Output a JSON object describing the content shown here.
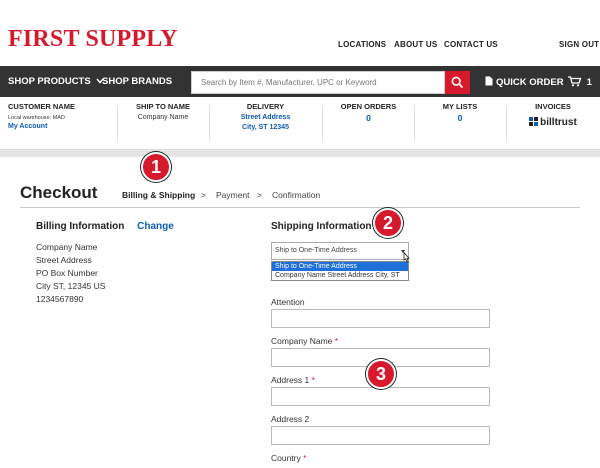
{
  "header": {
    "logo": "FIRST SUPPLY",
    "links": [
      "LOCATIONS",
      "ABOUT US",
      "CONTACT US",
      "SIGN OUT"
    ]
  },
  "nav": {
    "shop_products": "SHOP PRODUCTS",
    "shop_brands": "SHOP BRANDS",
    "search_placeholder": "Search by Item #, Manufacturer, UPC or Keyword",
    "quick_order": "QUICK ORDER",
    "cart_count": "1"
  },
  "account": {
    "customer_name": {
      "title": "CUSTOMER NAME",
      "warehouse": "Local warehouse: MAD",
      "link": "My Account"
    },
    "ship_to": {
      "title": "SHIP TO NAME",
      "value": "Company Name"
    },
    "delivery": {
      "title": "DELIVERY",
      "line1": "Street Address",
      "line2": "City, ST 12345"
    },
    "open_orders": {
      "title": "OPEN ORDERS",
      "value": "0"
    },
    "my_lists": {
      "title": "MY LISTS",
      "value": "0"
    },
    "invoices": {
      "title": "INVOICES",
      "brand": "billtrust"
    }
  },
  "checkout": {
    "title": "Checkout",
    "steps": [
      "Billing & Shipping",
      "Payment",
      "Confirmation"
    ],
    "separator": ">"
  },
  "billing": {
    "title": "Billing Information",
    "change": "Change",
    "lines": [
      "Company Name",
      "Street Address",
      "PO Box Number",
      "City ST, 12345 US",
      "1234567890"
    ]
  },
  "shipping": {
    "title": "Shipping Information",
    "select_value": "Ship to One-Time Address",
    "options": [
      "Ship to One-Time Address",
      "Company Name Street Address City, ST"
    ],
    "fields": [
      {
        "label": "Attention",
        "required": false
      },
      {
        "label": "Company Name",
        "required": true
      },
      {
        "label": "Address 1",
        "required": true
      },
      {
        "label": "Address 2",
        "required": false
      },
      {
        "label": "Country",
        "required": true
      }
    ],
    "required_mark": "*"
  },
  "markers": [
    "1",
    "2",
    "3"
  ],
  "colors": {
    "brand_red": "#d7192d",
    "nav_dark": "#333333",
    "link_blue": "#0b5bb5"
  }
}
